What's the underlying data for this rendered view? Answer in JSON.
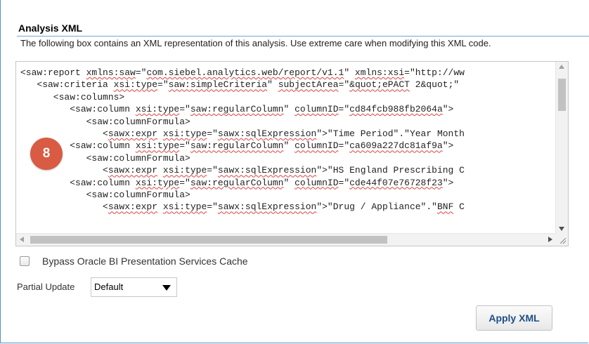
{
  "section": {
    "title": "Analysis XML",
    "description": "The following box contains an XML representation of this analysis. Use extreme care when modifying this XML code."
  },
  "xml_lines": [
    [
      {
        "t": "<saw:report "
      },
      {
        "t": "xmlns:saw",
        "sq": true
      },
      {
        "t": "=\""
      },
      {
        "t": "com.siebel.analytics.web/report/v1.1",
        "sq": true
      },
      {
        "t": "\" "
      },
      {
        "t": "xmlns:xsi",
        "sq": true
      },
      {
        "t": "=\"http://ww"
      }
    ],
    [
      {
        "t": "   <saw:criteria "
      },
      {
        "t": "xsi:type",
        "sq": true
      },
      {
        "t": "=\""
      },
      {
        "t": "saw:simpleCriteria",
        "sq": true
      },
      {
        "t": "\" "
      },
      {
        "t": "subjectArea",
        "sq": true
      },
      {
        "t": "=\""
      },
      {
        "t": "&quot;ePACT",
        "sq": true
      },
      {
        "t": " 2&quot;\""
      }
    ],
    [
      {
        "t": "      <saw:columns>"
      }
    ],
    [
      {
        "t": "         <saw:column "
      },
      {
        "t": "xsi:type",
        "sq": true
      },
      {
        "t": "=\""
      },
      {
        "t": "saw:regularColumn",
        "sq": true
      },
      {
        "t": "\" "
      },
      {
        "t": "columnID",
        "sq": true
      },
      {
        "t": "=\""
      },
      {
        "t": "cd84fcb988fb2064a",
        "sq": true
      },
      {
        "t": "\">"
      }
    ],
    [
      {
        "t": "            <saw:columnFormula>"
      }
    ],
    [
      {
        "t": "               <"
      },
      {
        "t": "sawx:expr",
        "sq": true
      },
      {
        "t": " "
      },
      {
        "t": "xsi:type",
        "sq": true
      },
      {
        "t": "=\""
      },
      {
        "t": "sawx:sqlExpression",
        "sq": true
      },
      {
        "t": "\">\"Time Period\".\"Year Month"
      }
    ],
    [
      {
        "t": "         <saw:column "
      },
      {
        "t": "xsi:type",
        "sq": true
      },
      {
        "t": "=\""
      },
      {
        "t": "saw:regularColumn",
        "sq": true
      },
      {
        "t": "\" "
      },
      {
        "t": "columnID",
        "sq": true
      },
      {
        "t": "=\""
      },
      {
        "t": "ca609a227dc81af9a",
        "sq": true
      },
      {
        "t": "\">"
      }
    ],
    [
      {
        "t": "            <saw:columnFormula>"
      }
    ],
    [
      {
        "t": "               <"
      },
      {
        "t": "sawx:expr",
        "sq": true
      },
      {
        "t": " "
      },
      {
        "t": "xsi:type",
        "sq": true
      },
      {
        "t": "=\""
      },
      {
        "t": "sawx:sqlExpression",
        "sq": true
      },
      {
        "t": "\">\"HS England Prescribing C"
      }
    ],
    [
      {
        "t": "         <saw:column "
      },
      {
        "t": "xsi:type",
        "sq": true
      },
      {
        "t": "=\""
      },
      {
        "t": "saw:regularColumn",
        "sq": true
      },
      {
        "t": "\" "
      },
      {
        "t": "columnID",
        "sq": true
      },
      {
        "t": "=\""
      },
      {
        "t": "cde44f07e76728f23",
        "sq": true
      },
      {
        "t": "\">"
      }
    ],
    [
      {
        "t": "            <saw:columnFormula>"
      }
    ],
    [
      {
        "t": "               <"
      },
      {
        "t": "sawx:expr",
        "sq": true
      },
      {
        "t": " "
      },
      {
        "t": "xsi:type",
        "sq": true
      },
      {
        "t": "=\""
      },
      {
        "t": "sawx:sqlExpression",
        "sq": true
      },
      {
        "t": "\">\"Drug / Appliance\".\""
      },
      {
        "t": "BNF",
        "sq": true
      },
      {
        "t": " C"
      }
    ]
  ],
  "badge": {
    "number": "8",
    "color": "#d95b43"
  },
  "bypass_cache": {
    "label": "Bypass Oracle BI Presentation Services Cache",
    "checked": false
  },
  "partial_update": {
    "label": "Partial Update",
    "selected": "Default"
  },
  "apply_button": {
    "label": "Apply XML"
  },
  "colors": {
    "accent": "#5b8ec8",
    "button_text": "#1d4f85",
    "squiggle": "#e04040"
  }
}
